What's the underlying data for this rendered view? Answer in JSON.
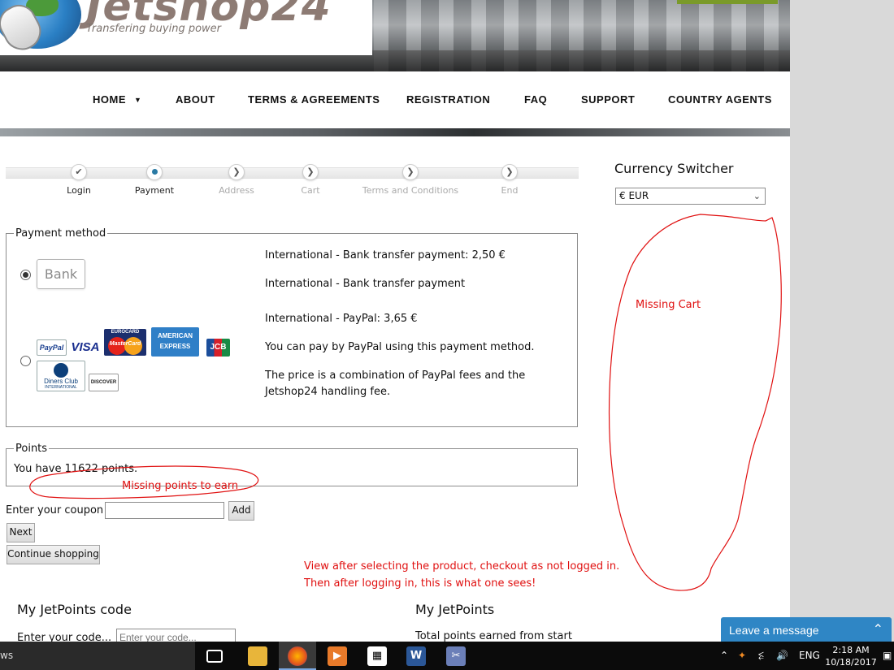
{
  "header": {
    "logo_text": "Jetshop24",
    "tagline": "Transfering buying power"
  },
  "nav": {
    "items": [
      {
        "label": "HOME",
        "has_caret": true
      },
      {
        "label": "ABOUT"
      },
      {
        "label": "TERMS & AGREEMENTS"
      },
      {
        "label": "REGISTRATION"
      },
      {
        "label": "FAQ"
      },
      {
        "label": "SUPPORT"
      },
      {
        "label": "COUNTRY AGENTS"
      }
    ]
  },
  "steps": [
    {
      "label": "Login",
      "state": "done",
      "icon": "check-icon"
    },
    {
      "label": "Payment",
      "state": "current",
      "icon": "dot-icon"
    },
    {
      "label": "Address",
      "state": "upcoming",
      "icon": "chevron-right-icon"
    },
    {
      "label": "Cart",
      "state": "upcoming",
      "icon": "chevron-right-icon"
    },
    {
      "label": "Terms and Conditions",
      "state": "upcoming",
      "icon": "chevron-right-icon"
    },
    {
      "label": "End",
      "state": "upcoming",
      "icon": "chevron-right-icon"
    }
  ],
  "payment": {
    "legend": "Payment method",
    "bank": {
      "logo_label": "Bank",
      "selected": true,
      "title": "International - Bank transfer payment: 2,50 €",
      "description": "International - Bank transfer payment"
    },
    "paypal": {
      "selected": false,
      "title": "International - PayPal: 3,65 €",
      "description": "You can pay by PayPal using this payment method.",
      "note_line1": "The price is a combination of PayPal fees and the",
      "note_line2": "Jetshop24 handling fee.",
      "cards": {
        "paypal": "PayPal",
        "visa": "VISA",
        "mastercard_top": "EUROCARD",
        "mastercard": "MasterCard",
        "amex_line1": "AMERICAN",
        "amex_line2": "EXPRESS",
        "jcb": "JCB",
        "diners_line1": "Diners Club",
        "diners_line2": "INTERNATIONAL",
        "discover": "DISCOVER"
      }
    }
  },
  "points": {
    "legend": "Points",
    "text": "You have 11622 points."
  },
  "coupon": {
    "label": "Enter your coupon",
    "value": "",
    "add_label": "Add"
  },
  "buttons": {
    "next": "Next",
    "continue": "Continue shopping"
  },
  "bottom": {
    "code_heading": "My JetPoints code",
    "code_label": "Enter your code...",
    "code_placeholder": "Enter your code...",
    "points_heading": "My JetPoints",
    "points_sub": "Total points earned from start"
  },
  "sidebar": {
    "currency_title": "Currency Switcher",
    "currency_selected": "€ EUR"
  },
  "annotations": {
    "missing_cart": "Missing Cart",
    "missing_points": "Missing points to earn",
    "note_line1": "View after selecting the product, checkout as not logged in.",
    "note_line2": "Then after logging in, this is what one sees!",
    "color": "#e01010"
  },
  "chat": {
    "label": "Leave a message",
    "color": "#2f86c5"
  },
  "taskbar": {
    "left_text": "ws",
    "lang": "ENG",
    "time": "2:18 AM",
    "date": "10/18/2017"
  }
}
